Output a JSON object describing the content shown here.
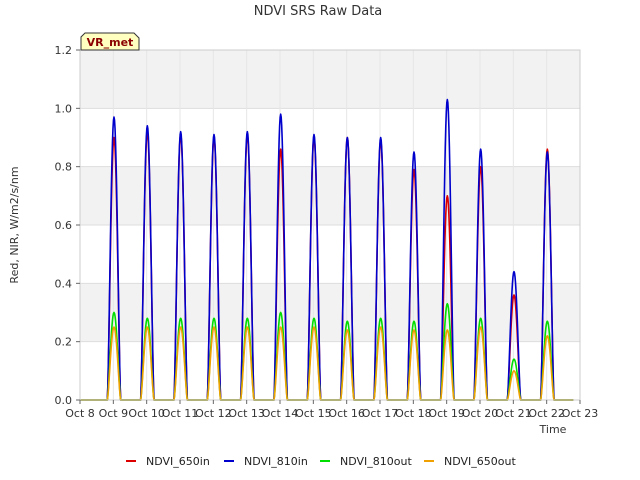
{
  "chart_data": {
    "type": "line",
    "title": "NDVI SRS Raw Data",
    "xlabel": "Time",
    "ylabel": "Red, NIR, W/m2/s/nm",
    "badge": "VR_met",
    "x_ticks": [
      "Oct 8",
      "Oct 9",
      "Oct 10",
      "Oct 11",
      "Oct 12",
      "Oct 13",
      "Oct 14",
      "Oct 15",
      "Oct 16",
      "Oct 17",
      "Oct 18",
      "Oct 19",
      "Oct 20",
      "Oct 21",
      "Oct 22",
      "Oct 23"
    ],
    "xlim": [
      0,
      15
    ],
    "x_start_label": "Oct 8",
    "y_ticks": [
      "0.0",
      "0.2",
      "0.4",
      "0.6",
      "0.8",
      "1.0",
      "1.2"
    ],
    "ylim": [
      0,
      1.2
    ],
    "grid": true,
    "legend_position": "bottom",
    "series": [
      {
        "name": "NDVI_650in",
        "color": "#dd0000",
        "peaks": [
          0.9,
          0.92,
          0.91,
          0.9,
          0.91,
          0.86,
          0.9,
          0.9,
          0.89,
          0.79,
          0.7,
          0.8,
          0.36,
          0.86
        ]
      },
      {
        "name": "NDVI_810in",
        "color": "#0000cc",
        "peaks": [
          0.97,
          0.94,
          0.92,
          0.91,
          0.92,
          0.98,
          0.91,
          0.9,
          0.9,
          0.85,
          1.03,
          0.86,
          0.44,
          0.85
        ]
      },
      {
        "name": "NDVI_810out",
        "color": "#00dd00",
        "peaks": [
          0.3,
          0.28,
          0.28,
          0.28,
          0.28,
          0.3,
          0.28,
          0.27,
          0.28,
          0.27,
          0.33,
          0.28,
          0.14,
          0.27
        ]
      },
      {
        "name": "NDVI_650out",
        "color": "#f0a000",
        "peaks": [
          0.25,
          0.25,
          0.25,
          0.25,
          0.25,
          0.25,
          0.25,
          0.24,
          0.25,
          0.24,
          0.24,
          0.25,
          0.1,
          0.22
        ]
      }
    ]
  }
}
